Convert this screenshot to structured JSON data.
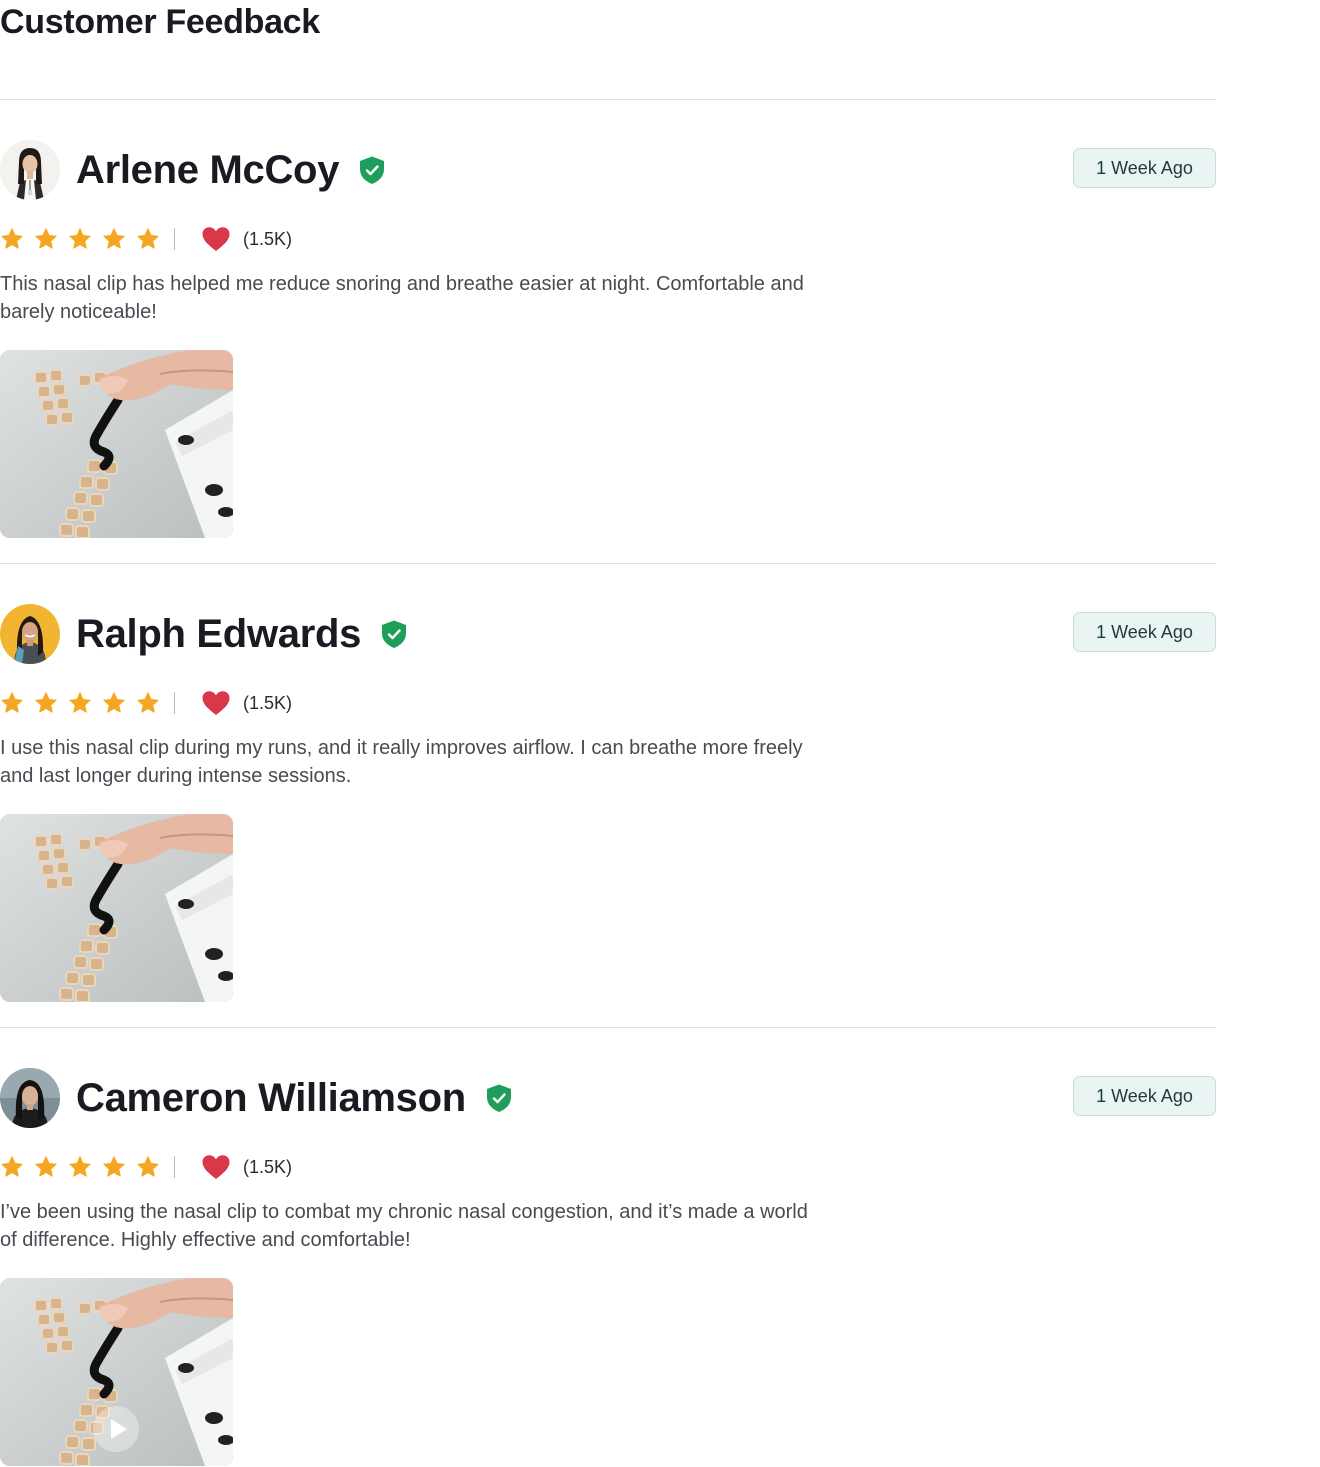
{
  "page": {
    "title": "Customer Feedback"
  },
  "reviews": [
    {
      "name": "Arlene McCoy",
      "date_label": "1 Week Ago",
      "rating": 5,
      "likes": "(1.5K)",
      "text": "This nasal clip has helped me reduce snoring and breathe easier at night. Comfortable and barely noticeable!",
      "media_type": "photo"
    },
    {
      "name": "Ralph Edwards",
      "date_label": "1 Week Ago",
      "rating": 5,
      "likes": "(1.5K)",
      "text": "I use this nasal clip during my runs, and it really improves airflow. I can breathe more freely and last longer during intense sessions.",
      "media_type": "photo"
    },
    {
      "name": "Cameron Williamson",
      "date_label": "1 Week Ago",
      "rating": 5,
      "likes": "(1.5K)",
      "text": "I’ve been using the nasal clip to combat my chronic nasal congestion, and it’s made a world of difference. Highly effective and comfortable!",
      "media_type": "video"
    }
  ],
  "colors": {
    "star": "#f5a623",
    "heart": "#d93848",
    "verified": "#1e9e5a",
    "badge_bg": "#eaf4f3",
    "divider": "#d7e6dd"
  },
  "icons": {
    "star": "star-icon",
    "heart": "heart-icon",
    "verified": "verified-shield-icon",
    "play": "play-button-icon"
  }
}
